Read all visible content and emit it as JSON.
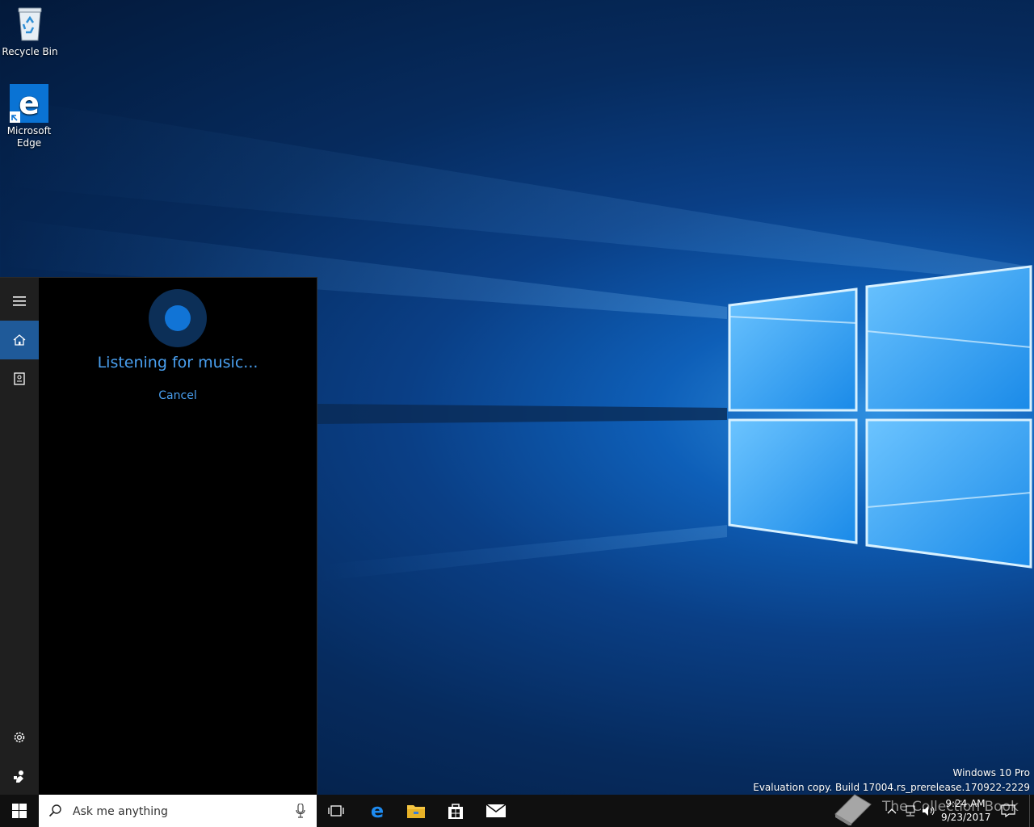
{
  "desktop": {
    "icons": [
      {
        "label": "Recycle Bin"
      },
      {
        "label": "Microsoft Edge"
      }
    ]
  },
  "cortana": {
    "status_text": "Listening for music...",
    "cancel_label": "Cancel",
    "rail": {
      "menu": "hamburger-icon",
      "home": "home-icon",
      "notebook": "notebook-icon",
      "settings": "gear-icon",
      "feedback": "feedback-icon"
    }
  },
  "watermark": {
    "edition": "Windows 10 Pro",
    "build": "Evaluation copy. Build 17004.rs_prerelease.170922-2229"
  },
  "taskbar": {
    "search_placeholder": "Ask me anything",
    "pinned": [
      "task-view",
      "edge",
      "file-explorer",
      "store",
      "mail"
    ],
    "clock": {
      "time": "9:24 AM",
      "date": "9/23/2017"
    },
    "overlay_text": "The Collection Book"
  },
  "colors": {
    "accent": "#1174d6",
    "cortana_text": "#4aa0f0",
    "taskbar": "#101010",
    "rail": "#1f1f1f"
  }
}
